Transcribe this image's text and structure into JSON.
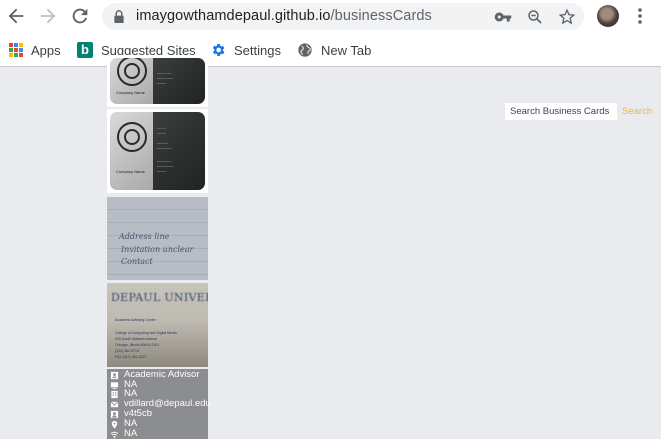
{
  "browser": {
    "url_host": "imaygowthamdepaul.github.io",
    "url_path": "/businessCards"
  },
  "bookmarks": [
    {
      "label": "Apps",
      "icon": "apps-grid-icon"
    },
    {
      "label": "Suggested Sites",
      "icon": "bing-icon"
    },
    {
      "label": "Settings",
      "icon": "gear-icon"
    },
    {
      "label": "New Tab",
      "icon": "globe-icon"
    }
  ],
  "search": {
    "placeholder": "Search Business Cards",
    "button_label": "Search",
    "accent_color": "#f2b632"
  },
  "cards": {
    "sample_company": "Company Name",
    "note_lines": [
      "Address line",
      "Invitation unclear",
      "Contact"
    ],
    "depaul_title": "DEPAUL UNIVERSITY",
    "depaul_lines": [
      "Academic Advising Center",
      "College of Computing and Digital Media",
      "243 South Wabash Avenue",
      "Chicago, Illinois 60604-2301",
      "(312) 362-8714",
      "FAX (312) 362-5327"
    ]
  },
  "details": [
    {
      "icon": "id-card-icon",
      "text": "Academic Advisor"
    },
    {
      "icon": "monitor-icon",
      "text": "NA"
    },
    {
      "icon": "building-icon",
      "text": "NA"
    },
    {
      "icon": "email-icon",
      "text": "vdillard@depaul.edu"
    },
    {
      "icon": "person-icon",
      "text": "v4t5cb"
    },
    {
      "icon": "location-pin-icon",
      "text": "NA"
    },
    {
      "icon": "wifi-icon",
      "text": "NA"
    }
  ]
}
